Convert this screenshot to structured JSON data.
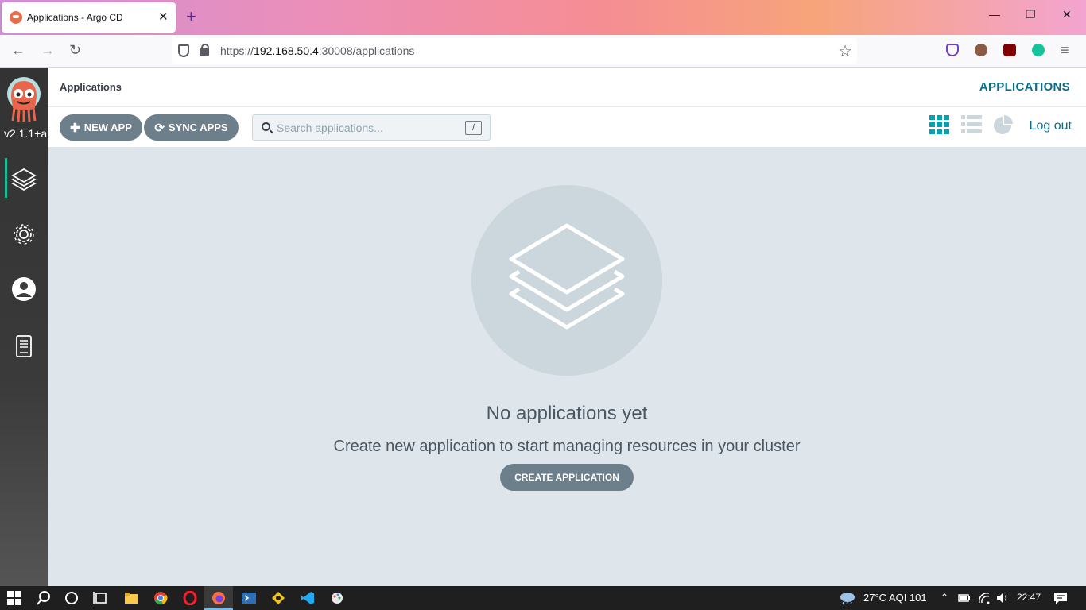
{
  "browser": {
    "tab_title": "Applications - Argo CD",
    "tab_close": "✕",
    "new_tab": "+",
    "url_scheme": "https://",
    "url_host": "192.168.50.4",
    "url_rest": ":30008/applications"
  },
  "window_controls": {
    "minimize": "—",
    "restore": "❐",
    "close": "✕"
  },
  "sidebar": {
    "version": "v2.1.1+a",
    "items": [
      {
        "name": "applications",
        "icon": "layers-icon",
        "active": true
      },
      {
        "name": "settings",
        "icon": "gear-icon",
        "active": false
      },
      {
        "name": "user-info",
        "icon": "user-icon",
        "active": false
      },
      {
        "name": "documentation",
        "icon": "docs-icon",
        "active": false
      }
    ]
  },
  "header": {
    "breadcrumb": "Applications",
    "title": "APPLICATIONS"
  },
  "toolbar": {
    "new_app": "NEW APP",
    "sync_apps": "SYNC APPS",
    "search_placeholder": "Search applications...",
    "search_shortcut": "/",
    "logout": "Log out"
  },
  "empty_state": {
    "title": "No applications yet",
    "subtitle": "Create new application to start managing resources in your cluster",
    "button": "CREATE APPLICATION"
  },
  "taskbar": {
    "weather": "27°C  AQI 101",
    "time": "22:47"
  },
  "colors": {
    "sidebar_bg": "#333333",
    "accent_teal": "#0b6e86",
    "active_indicator": "#18be94",
    "button_bg": "#6d7f8b",
    "main_bg": "#dee6eb"
  }
}
